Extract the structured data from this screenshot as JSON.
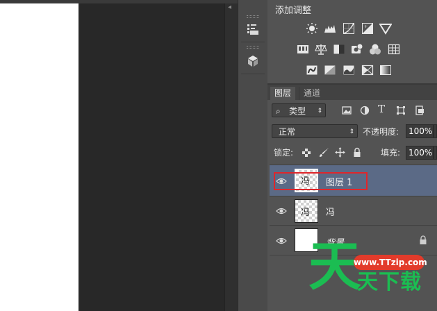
{
  "adjustments": {
    "title": "添加调整",
    "icons_row1": [
      "brightness-contrast-icon",
      "levels-icon",
      "curves-icon",
      "exposure-icon",
      "vibrance-icon"
    ],
    "icons_row2": [
      "hue-saturation-icon",
      "color-balance-icon",
      "black-white-icon",
      "photo-filter-icon",
      "channel-mixer-icon",
      "color-lookup-icon"
    ],
    "icons_row3": [
      "invert-icon",
      "posterize-icon",
      "threshold-icon",
      "gradient-map-icon",
      "selective-color-icon"
    ]
  },
  "layers_panel": {
    "tabs": [
      "图层",
      "通道"
    ],
    "filter_kind": "类型",
    "blend_mode": "正常",
    "opacity_label": "不透明度:",
    "opacity_value": "100%",
    "lock_label": "锁定:",
    "fill_label": "填充:",
    "fill_value": "100%",
    "layers": [
      {
        "name": "图层 1",
        "thumb_text": "冯",
        "selected": true,
        "highlighted": true
      },
      {
        "name": "冯",
        "thumb_text": "冯",
        "selected": false
      },
      {
        "name": "背景",
        "thumb_text": "",
        "selected": false,
        "locked": true
      }
    ]
  },
  "watermark": {
    "url": "www.TTzip.com",
    "glyph": "天",
    "text": "天下载"
  },
  "colors": {
    "selected_row": "#5b6a86",
    "highlight_box": "#e0262b",
    "watermark_green": "#1bbd52",
    "watermark_red": "#e23b2b"
  }
}
